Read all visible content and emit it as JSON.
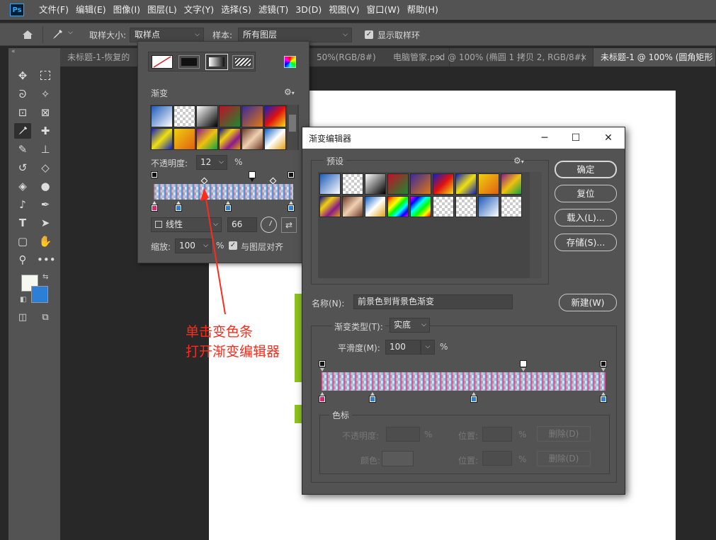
{
  "app": {
    "logo": "Ps"
  },
  "menu": [
    "文件(F)",
    "编辑(E)",
    "图像(I)",
    "图层(L)",
    "文字(Y)",
    "选择(S)",
    "滤镜(T)",
    "3D(D)",
    "视图(V)",
    "窗口(W)",
    "帮助(H)"
  ],
  "options_bar": {
    "sample_size_label": "取样大小:",
    "sample_size_value": "取样点",
    "sample_label": "样本:",
    "sample_value": "所有图层",
    "show_ring_label": "显示取样环",
    "show_ring_checked": true
  },
  "tabs": [
    {
      "label": "未标题-1-恢复的",
      "active": false
    },
    {
      "label": "50%(RGB/8#)",
      "active": false
    },
    {
      "label": "电脑管家.psd @ 100% (椭圆 1 拷贝 2, RGB/8#)",
      "active": false
    },
    {
      "label": "未标题-1 @ 100% (圆角矩形",
      "active": true
    }
  ],
  "tab_close": "×",
  "gradient_panel": {
    "title": "渐变",
    "opacity_label": "不透明度:",
    "opacity_value": "12",
    "percent": "%",
    "style_value": "线性",
    "angle_value": "66",
    "scale_label": "缩放:",
    "scale_value": "100",
    "align_label": "与图层对齐",
    "align_checked": true
  },
  "gradient_editor": {
    "title": "渐变编辑器",
    "presets_label": "预设",
    "buttons": {
      "ok": "确定",
      "reset": "复位",
      "load": "载入(L)...",
      "save": "存储(S)...",
      "new": "新建(W)"
    },
    "name_label": "名称(N):",
    "name_value": "前景色到背景色渐变",
    "type_label": "渐变类型(T):",
    "type_value": "实底",
    "smooth_label": "平滑度(M):",
    "smooth_value": "100",
    "percent": "%",
    "stops_group_label": "色标",
    "stop_opacity_label": "不透明度:",
    "stop_color_label": "颜色:",
    "location_label": "位置:",
    "delete_label": "删除(D)"
  },
  "annotation": {
    "line1": "单击变色条",
    "line2": "打开渐变编辑器"
  },
  "colors": {
    "foreground": "#f4f8f0",
    "background": "#2b7fd6",
    "gradient_start": "#e2216e",
    "gradient_end": "#3d8ce6",
    "annotation": "#ff2a1a",
    "canvas_accent": "#8dc21f"
  },
  "icons": {
    "window_min": "─",
    "window_max": "☐",
    "window_close": "✕",
    "chevron": "⌵",
    "gear": "⚙"
  }
}
